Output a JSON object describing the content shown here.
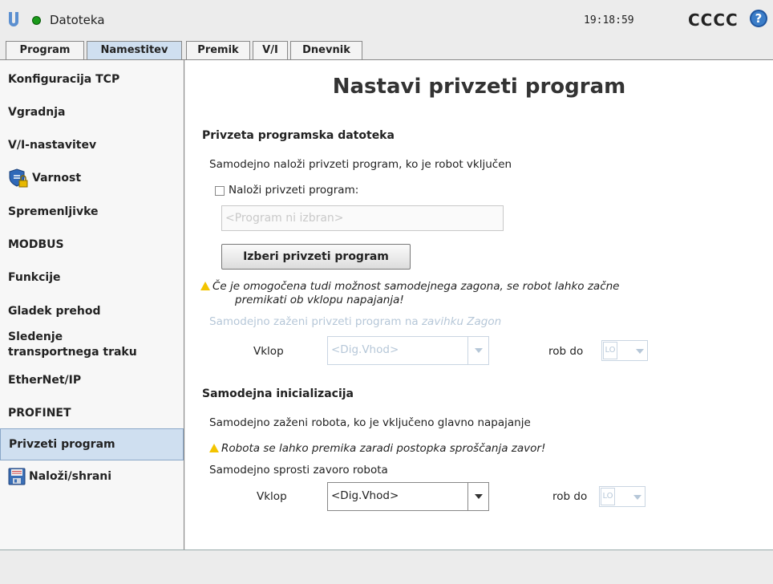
{
  "header": {
    "app_name": "Datoteka",
    "time": "19:18:59",
    "robot_name": "CCCC",
    "help_symbol": "?",
    "status_color": "#1a9a1a"
  },
  "tabs": [
    {
      "label": "Program",
      "active": false
    },
    {
      "label": "Namestitev",
      "active": true
    },
    {
      "label": "Premik",
      "active": false
    },
    {
      "label": "V/I",
      "active": false
    },
    {
      "label": "Dnevnik",
      "active": false
    }
  ],
  "sidebar": {
    "items": [
      {
        "label": "Konfiguracija TCP",
        "icon": null
      },
      {
        "label": "Vgradnja",
        "icon": null
      },
      {
        "label": "V/I-nastavitev",
        "icon": null
      },
      {
        "label": "Varnost",
        "icon": "shield-lock-icon"
      },
      {
        "label": "Spremenljivke",
        "icon": null
      },
      {
        "label": "MODBUS",
        "icon": null
      },
      {
        "label": "Funkcije",
        "icon": null
      },
      {
        "label": "Gladek prehod",
        "icon": null
      },
      {
        "label_line1": "Sledenje",
        "label_line2": "transportnega traku",
        "icon": null
      },
      {
        "label": "EtherNet/IP",
        "icon": null
      },
      {
        "label": "PROFINET",
        "icon": null
      },
      {
        "label": "Privzeti program",
        "icon": null,
        "selected": true
      },
      {
        "label": "Naloži/shrani",
        "icon": "floppy-disk-icon"
      }
    ]
  },
  "main": {
    "title": "Nastavi privzeti program",
    "section1": {
      "heading": "Privzeta programska datoteka",
      "description": "Samodejno naloži privzeti program, ko je robot vključen",
      "checkbox_label": "Naloži privzeti program:",
      "checkbox_checked": false,
      "program_field_placeholder": "<Program ni izbran>",
      "select_button": "Izberi privzeti program",
      "warning_line1": "Če je omogočena tudi možnost samodejnega zagona, se robot lahko začne",
      "warning_line2": "premikati ob vklopu napajanja!",
      "autostart_text": "Samodejno zaženi privzeti program na ",
      "autostart_link": "zavihku Zagon",
      "trigger_label": "Vklop",
      "trigger_value": "<Dig.Vhod>",
      "edge_label": "rob do",
      "edge_value": "LO"
    },
    "section2": {
      "heading": "Samodejna inicializacija",
      "description": "Samodejno zaženi robota, ko je vključeno glavno napajanje",
      "warning": "Robota se lahko premika zaradi postopka sproščanja zavor!",
      "brake_text": "Samodejno sprosti zavoro robota",
      "trigger_label": "Vklop",
      "trigger_value": "<Dig.Vhod>",
      "edge_label": "rob do",
      "edge_value": "LO"
    }
  }
}
